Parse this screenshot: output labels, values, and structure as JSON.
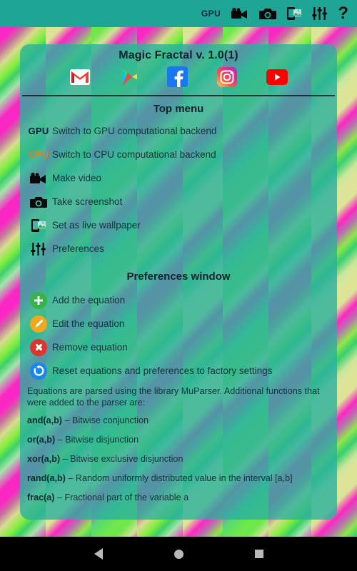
{
  "statusbar": {
    "items": [
      {
        "name": "gpu-indicator",
        "label": "GPU",
        "type": "text"
      },
      {
        "name": "video-camera-icon",
        "label": "Make video",
        "type": "icon"
      },
      {
        "name": "camera-icon",
        "label": "Take screenshot",
        "type": "icon"
      },
      {
        "name": "live-wallpaper-icon",
        "label": "Set as live wallpaper",
        "type": "icon"
      },
      {
        "name": "preferences-icon",
        "label": "Preferences",
        "type": "icon"
      },
      {
        "name": "help-icon",
        "label": "?",
        "type": "text"
      }
    ]
  },
  "dialog": {
    "title": "Magic Fractal v. 1.0(1)",
    "social": [
      {
        "name": "gmail-icon",
        "label": "Gmail"
      },
      {
        "name": "google-play-icon",
        "label": "Google Play"
      },
      {
        "name": "facebook-icon",
        "label": "Facebook"
      },
      {
        "name": "instagram-icon",
        "label": "Instagram"
      },
      {
        "name": "youtube-icon",
        "label": "YouTube"
      }
    ],
    "top_menu": {
      "heading": "Top menu",
      "items": [
        {
          "icon": "gpu-badge",
          "icon_text": "GPU",
          "label": "Switch to GPU computational backend"
        },
        {
          "icon": "cpu-badge",
          "icon_text": "CPU",
          "label": "Switch to CPU computational backend"
        },
        {
          "icon": "video-camera-icon",
          "icon_text": "",
          "label": "Make video"
        },
        {
          "icon": "camera-icon",
          "icon_text": "",
          "label": "Take screenshot"
        },
        {
          "icon": "live-wallpaper-icon",
          "icon_text": "",
          "label": "Set as live wallpaper"
        },
        {
          "icon": "preferences-icon",
          "icon_text": "",
          "label": "Preferences"
        }
      ]
    },
    "preferences_window": {
      "heading": "Preferences window",
      "items": [
        {
          "icon": "add-icon",
          "label": "Add the equation"
        },
        {
          "icon": "edit-icon",
          "label": "Edit the equation"
        },
        {
          "icon": "remove-icon",
          "label": "Remove equation"
        },
        {
          "icon": "reset-icon",
          "label": "Reset equations and preferences to factory settings"
        }
      ]
    },
    "body": {
      "intro": "Equations are parsed using the library MuParser. Additional functions that were added to the parser are:",
      "functions": [
        {
          "signature": "and(a,b)",
          "desc": " – Bitwise conjunction"
        },
        {
          "signature": "or(a,b)",
          "desc": " – Bitwise disjunction"
        },
        {
          "signature": "xor(a,b)",
          "desc": " – Bitwise exclusive disjunction"
        },
        {
          "signature": "rand(a,b)",
          "desc": " – Random uniformly distributed value in the interval [a,b]"
        },
        {
          "signature": "frac(a)",
          "desc": " – Fractional part of the variable a"
        }
      ]
    }
  },
  "navbar": {
    "items": [
      {
        "name": "nav-back-button",
        "label": "Back"
      },
      {
        "name": "nav-home-button",
        "label": "Home"
      },
      {
        "name": "nav-recents-button",
        "label": "Recents"
      }
    ]
  },
  "colors": {
    "status_bar": "#1fa596",
    "dialog": "#2ab09e",
    "gpu_badge": "#0d1440",
    "cpu_badge": "#f07a14",
    "add": "#37b34a",
    "edit": "#f0a81e",
    "remove": "#e0342b",
    "reset": "#1a88e8"
  }
}
